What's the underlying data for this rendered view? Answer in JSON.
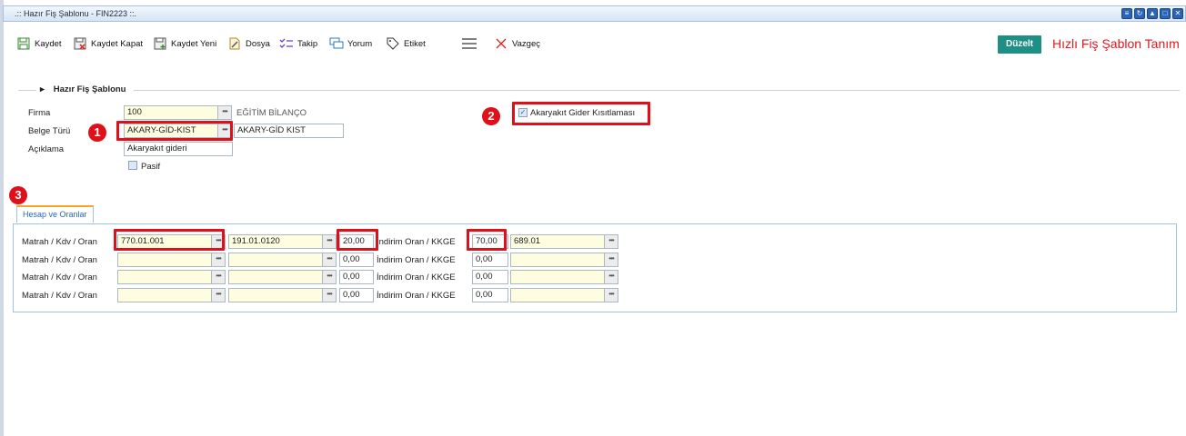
{
  "window": {
    "title": ".:: Hazır Fiş Şablonu - FIN2223 ::."
  },
  "toolbar": {
    "save": "Kaydet",
    "save_close": "Kaydet Kapat",
    "save_new": "Kaydet Yeni",
    "file": "Dosya",
    "follow": "Takip",
    "comment": "Yorum",
    "tag": "Etiket",
    "cancel": "Vazgeç",
    "edit": "Düzelt"
  },
  "page_title": "Hızlı Fiş Şablon Tanım",
  "section": {
    "title": "Hazır Fiş Şablonu"
  },
  "form": {
    "firma_label": "Firma",
    "firma_value": "100",
    "firma_name": "EĞİTİM BİLANÇO",
    "belge_label": "Belge Türü",
    "belge_value": "AKARY-GİD-KIST",
    "belge_name": "AKARY-GİD KIST",
    "aciklama_label": "Açıklama",
    "aciklama_value": "Akaryakıt gideri",
    "pasif_label": "Pasif",
    "akaryakit_label": "Akaryakıt Gider Kısıtlaması",
    "akaryakit_checked": true
  },
  "badges": [
    "1",
    "2",
    "3"
  ],
  "tab": {
    "label": "Hesap ve Oranlar"
  },
  "rows": [
    {
      "label": "Matrah / Kdv / Oran",
      "matrah": "770.01.001",
      "kdv": "191.01.0120",
      "oran": "20,00",
      "mid_label": "İndirim Oran / KKGE",
      "indirim": "70,00",
      "kkge": "689.01"
    },
    {
      "label": "Matrah / Kdv / Oran",
      "matrah": "",
      "kdv": "",
      "oran": "0,00",
      "mid_label": "İndirim Oran / KKGE",
      "indirim": "0,00",
      "kkge": ""
    },
    {
      "label": "Matrah / Kdv / Oran",
      "matrah": "",
      "kdv": "",
      "oran": "0,00",
      "mid_label": "İndirim Oran / KKGE",
      "indirim": "0,00",
      "kkge": ""
    },
    {
      "label": "Matrah / Kdv / Oran",
      "matrah": "",
      "kdv": "",
      "oran": "0,00",
      "mid_label": "İndirim Oran / KKGE",
      "indirim": "0,00",
      "kkge": ""
    }
  ],
  "colors": {
    "accent_red": "#e0101a",
    "edit_button": "#1e8f84",
    "title_red": "#e0181e"
  }
}
